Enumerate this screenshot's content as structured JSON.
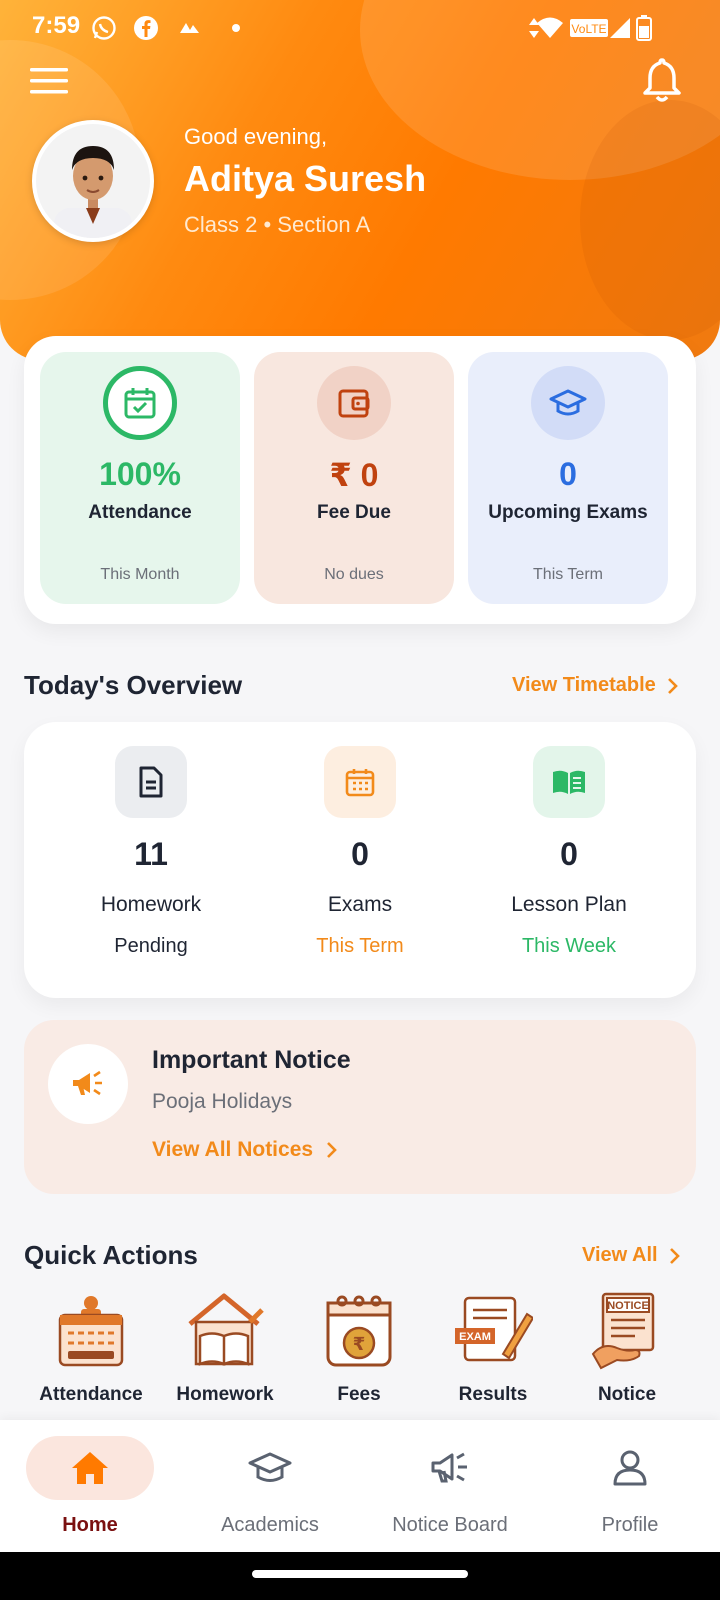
{
  "status_bar": {
    "time": "7:59"
  },
  "header": {
    "greeting": "Good evening,",
    "student_name": "Aditya Suresh",
    "class_info": "Class 2 • Section A"
  },
  "stats": [
    {
      "value": "100%",
      "label": "Attendance",
      "sub": "This Month",
      "color": "#2cb866",
      "bg": "#e6f6ec"
    },
    {
      "value": "₹ 0",
      "label": "Fee Due",
      "sub": "No dues",
      "color": "#c0420f",
      "bg": "#f8e7df"
    },
    {
      "value": "0",
      "label": "Upcoming Exams",
      "sub": "This Term",
      "color": "#2b6de0",
      "bg": "#e9eefb"
    }
  ],
  "overview": {
    "title": "Today's Overview",
    "link": "View Timetable",
    "items": [
      {
        "value": "11",
        "label": "Homework",
        "sub": "Pending",
        "sub_color": "#1f2533"
      },
      {
        "value": "0",
        "label": "Exams",
        "sub": "This Term",
        "sub_color": "#f28a1a"
      },
      {
        "value": "0",
        "label": "Lesson Plan",
        "sub": "This Week",
        "sub_color": "#2cb866"
      }
    ]
  },
  "notice": {
    "title": "Important Notice",
    "subtitle": "Pooja Holidays",
    "link": "View All Notices"
  },
  "quick_actions": {
    "title": "Quick Actions",
    "link": "View All",
    "items": [
      {
        "label": "Attendance",
        "icon": "attendance-icon"
      },
      {
        "label": "Homework",
        "icon": "homework-icon"
      },
      {
        "label": "Fees",
        "icon": "fees-icon"
      },
      {
        "label": "Results",
        "icon": "results-icon"
      },
      {
        "label": "Notice",
        "icon": "notice-icon"
      }
    ]
  },
  "nav": [
    {
      "label": "Home",
      "icon": "home-icon",
      "active": true
    },
    {
      "label": "Academics",
      "icon": "graduation-cap-icon",
      "active": false
    },
    {
      "label": "Notice Board",
      "icon": "megaphone-icon",
      "active": false
    },
    {
      "label": "Profile",
      "icon": "person-icon",
      "active": false
    }
  ],
  "colors": {
    "accent": "#ff7a00",
    "link": "#f28a1a",
    "active_nav": "#7a1010"
  }
}
